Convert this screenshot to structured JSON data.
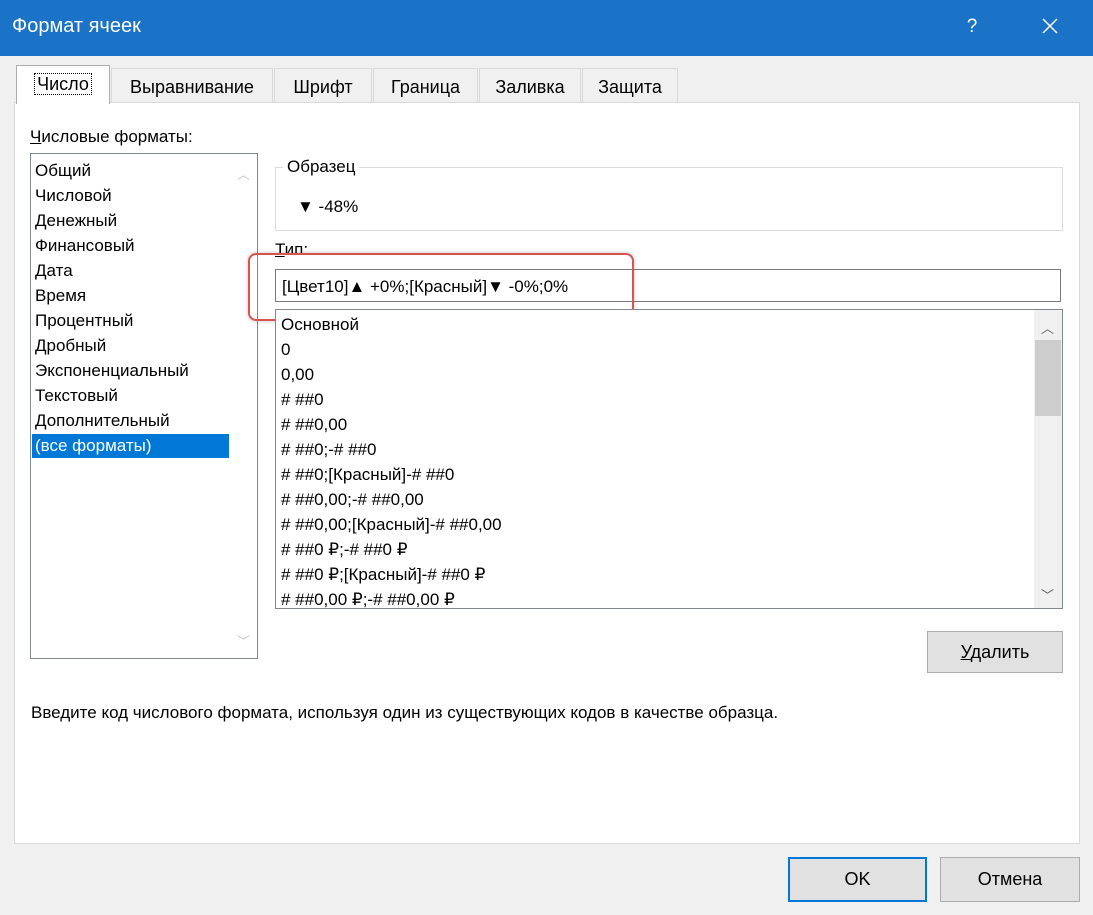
{
  "window": {
    "title": "Формат ячеек",
    "help_label": "?"
  },
  "tabs": [
    {
      "label": "Число",
      "active": true
    },
    {
      "label": "Выравнивание",
      "active": false
    },
    {
      "label": "Шрифт",
      "active": false
    },
    {
      "label": "Граница",
      "active": false
    },
    {
      "label": "Заливка",
      "active": false
    },
    {
      "label": "Защита",
      "active": false
    }
  ],
  "categories": {
    "label_first": "Ч",
    "label_rest": "исловые форматы:",
    "items": [
      "Общий",
      "Числовой",
      "Денежный",
      "Финансовый",
      "Дата",
      "Время",
      "Процентный",
      "Дробный",
      "Экспоненциальный",
      "Текстовый",
      "Дополнительный",
      "(все форматы)"
    ],
    "selected_index": 11
  },
  "sample": {
    "legend": "Образец",
    "value": "▼ -48%"
  },
  "type": {
    "label_first": "Т",
    "label_rest": "ип:",
    "value": "[Цвет10]▲ +0%;[Красный]▼ -0%;0%"
  },
  "formats": [
    "Основной",
    "0",
    "0,00",
    "# ##0",
    "# ##0,00",
    "# ##0;-# ##0",
    "# ##0;[Красный]-# ##0",
    "# ##0,00;-# ##0,00",
    "# ##0,00;[Красный]-# ##0,00",
    "# ##0 ₽;-# ##0 ₽",
    "# ##0 ₽;[Красный]-# ##0 ₽",
    "# ##0,00 ₽;-# ##0,00 ₽"
  ],
  "delete_button": {
    "label_first": "У",
    "label_rest": "далить"
  },
  "hint": "Введите код числового формата, используя один из существующих кодов в качестве образца.",
  "buttons": {
    "ok": "OK",
    "cancel": "Отмена"
  },
  "colors": {
    "titlebar": "#1a73c6",
    "selection": "#0078d7",
    "highlight": "#d9534f"
  },
  "icons": {
    "close": "close-icon",
    "help": "help-icon",
    "scroll_up": "chevron-up-icon",
    "scroll_down": "chevron-down-icon"
  }
}
